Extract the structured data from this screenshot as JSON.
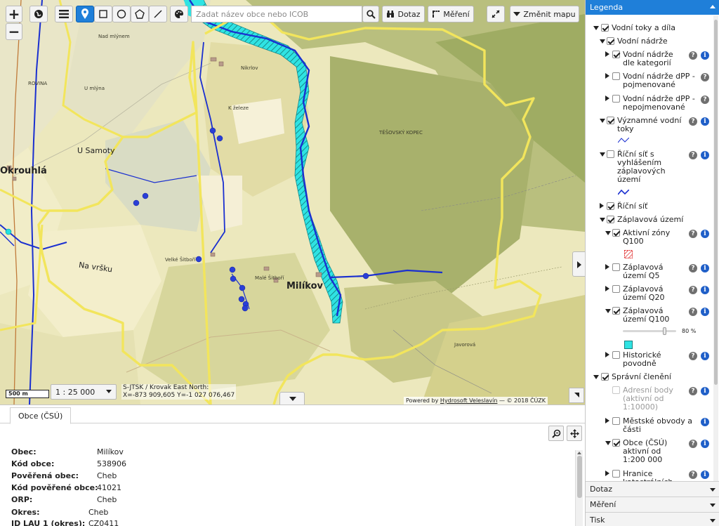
{
  "map": {
    "zoom_in": "+",
    "zoom_out": "−",
    "search_placeholder": "Zadat název obce nebo ICOB",
    "query_button": "Dotaz",
    "measure_button": "Měření",
    "change_map_button": "Změnit mapu",
    "scale_label": "500 m",
    "scale_select": "1 : 25 000",
    "crs_line1": "S-JTSK / Krovak East North:",
    "crs_line2": "X=-873 909,605 Y=-1 027 076,467",
    "attribution_prefix": "Powered by",
    "attribution_link": "Hydrosoft Veleslavín",
    "attribution_suffix": "— © 2018 ČÚZK",
    "labels": {
      "milikov": "Milíkov",
      "okrouhla": "Okrouhlá",
      "u_samoty": "U Samoty",
      "na_vrsku": "Na vršku",
      "velke_sitbori": "Velké Šitboří",
      "male_sitbori": "Malé Šitboří",
      "tesovsky_kopec": "TĚŠOVSKÝ KOPEC",
      "rovina": "ROVINA",
      "nikrlov": "Nikrlov",
      "k_zeleze": "K železe",
      "u_mlyna": "U mlýna",
      "nad_mlynem": "Nad mlýnem",
      "javorova": "Javorová"
    },
    "colors": {
      "boundary": "#f2e55c",
      "river": "#1a2fd0",
      "flood_zone": "#22e0e0",
      "hatch": "#2aa8a8"
    }
  },
  "bottom": {
    "tab_label": "Obce (ČSÚ)",
    "rows": [
      {
        "key": "Obec:",
        "value": "Milíkov"
      },
      {
        "key": "Kód obce:",
        "value": "538906"
      },
      {
        "key": "Pověřená obec:",
        "value": "Cheb"
      },
      {
        "key": "Kód pověřené obce:",
        "value": "41021"
      },
      {
        "key": "ORP:",
        "value": "Cheb"
      },
      {
        "key": "Okres:",
        "value": "Cheb"
      },
      {
        "key": "ID LAU 1 (okres):",
        "value": "CZ0411"
      }
    ]
  },
  "legend": {
    "title": "Legenda",
    "items": [
      {
        "label": "Vodní toky a díla",
        "checked": true
      },
      {
        "label": "Vodní nádrže",
        "checked": true
      },
      {
        "label": "Vodní nádrže dle kategorií",
        "checked": true
      },
      {
        "label": "Vodní nádrže dPP - pojmenované",
        "checked": false
      },
      {
        "label": "Vodní nádrže dPP - nepojmenované",
        "checked": false
      },
      {
        "label": "Významné vodní toky",
        "checked": true
      },
      {
        "label": "Říční síť s vyhlášením záplavových území",
        "checked": false
      },
      {
        "label": "Říční síť",
        "checked": true
      },
      {
        "label": "Záplavová území",
        "checked": true
      },
      {
        "label": "Aktivní zóny Q100",
        "checked": true
      },
      {
        "label": "Záplavová území Q5",
        "checked": false
      },
      {
        "label": "Záplavová území Q20",
        "checked": false
      },
      {
        "label": "Záplavová území Q100",
        "checked": true
      },
      {
        "label": "Historické povodně",
        "checked": false
      },
      {
        "label": "Správní členění",
        "checked": true
      },
      {
        "label": "Adresní body (aktivní od 1:10000)",
        "checked": false
      },
      {
        "label": "Městské obvody a části",
        "checked": false
      },
      {
        "label": "Obce (ČSÚ) aktivní od 1:200 000",
        "checked": true
      },
      {
        "label": "Hranice katastrálních",
        "checked": false
      }
    ],
    "opacity_value": "80 %",
    "help_glyph": "?",
    "info_glyph": "i"
  },
  "panels": {
    "dotaz": "Dotaz",
    "mereni": "Měření",
    "tisk": "Tisk"
  }
}
